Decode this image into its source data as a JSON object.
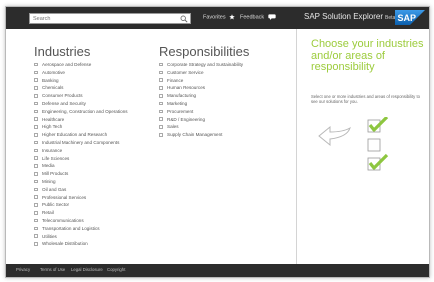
{
  "header": {
    "search_placeholder": "Search",
    "favorites_label": "Favorites",
    "feedback_label": "Feedback",
    "brand_title": "SAP Solution Explorer",
    "brand_beta": "Beta",
    "logo_text": "SAP"
  },
  "industries": {
    "title": "Industries",
    "items": [
      "Aerospace and Defense",
      "Automotive",
      "Banking",
      "Chemicals",
      "Consumer Products",
      "Defense and Security",
      "Engineering, Construction and Operations",
      "Healthcare",
      "High Tech",
      "Higher Education and Research",
      "Industrial Machinery and Components",
      "Insurance",
      "Life Sciences",
      "Media",
      "Mill Products",
      "Mining",
      "Oil and Gas",
      "Professional Services",
      "Public Sector",
      "Retail",
      "Telecommunications",
      "Transportation and Logistics",
      "Utilities",
      "Wholesale Distribution"
    ]
  },
  "responsibilities": {
    "title": "Responsibilities",
    "items": [
      "Corporate Strategy and Sustainability",
      "Customer Service",
      "Finance",
      "Human Resources",
      "Manufacturing",
      "Marketing",
      "Procurement",
      "R&D / Engineering",
      "Sales",
      "Supply Chain Management"
    ]
  },
  "panel": {
    "heading": "Choose your industries and/or areas of responsibility",
    "subtext": "Select one or more industries and areas of responsibility to see our solutions for you."
  },
  "footer": {
    "links": [
      "Privacy",
      "Terms of Use",
      "Legal Disclosure",
      "Copyright"
    ]
  },
  "colors": {
    "accent_green": "#8dc63f",
    "topbar": "#2c2c2c",
    "sap_blue": "#1a73c8"
  }
}
